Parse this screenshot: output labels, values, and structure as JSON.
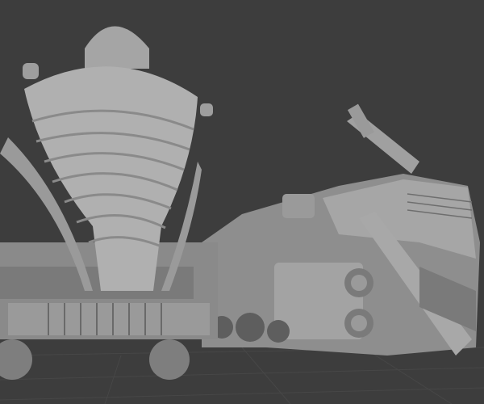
{
  "scene": {
    "background_color": "#3d3d3d",
    "floor_grid_color": "#4a4a4a",
    "model_light": "#b4b4b4",
    "model_mid": "#8c8c8c",
    "model_dark": "#5a5a5a",
    "objects": [
      "locomotive-front",
      "streamlined-train"
    ]
  }
}
